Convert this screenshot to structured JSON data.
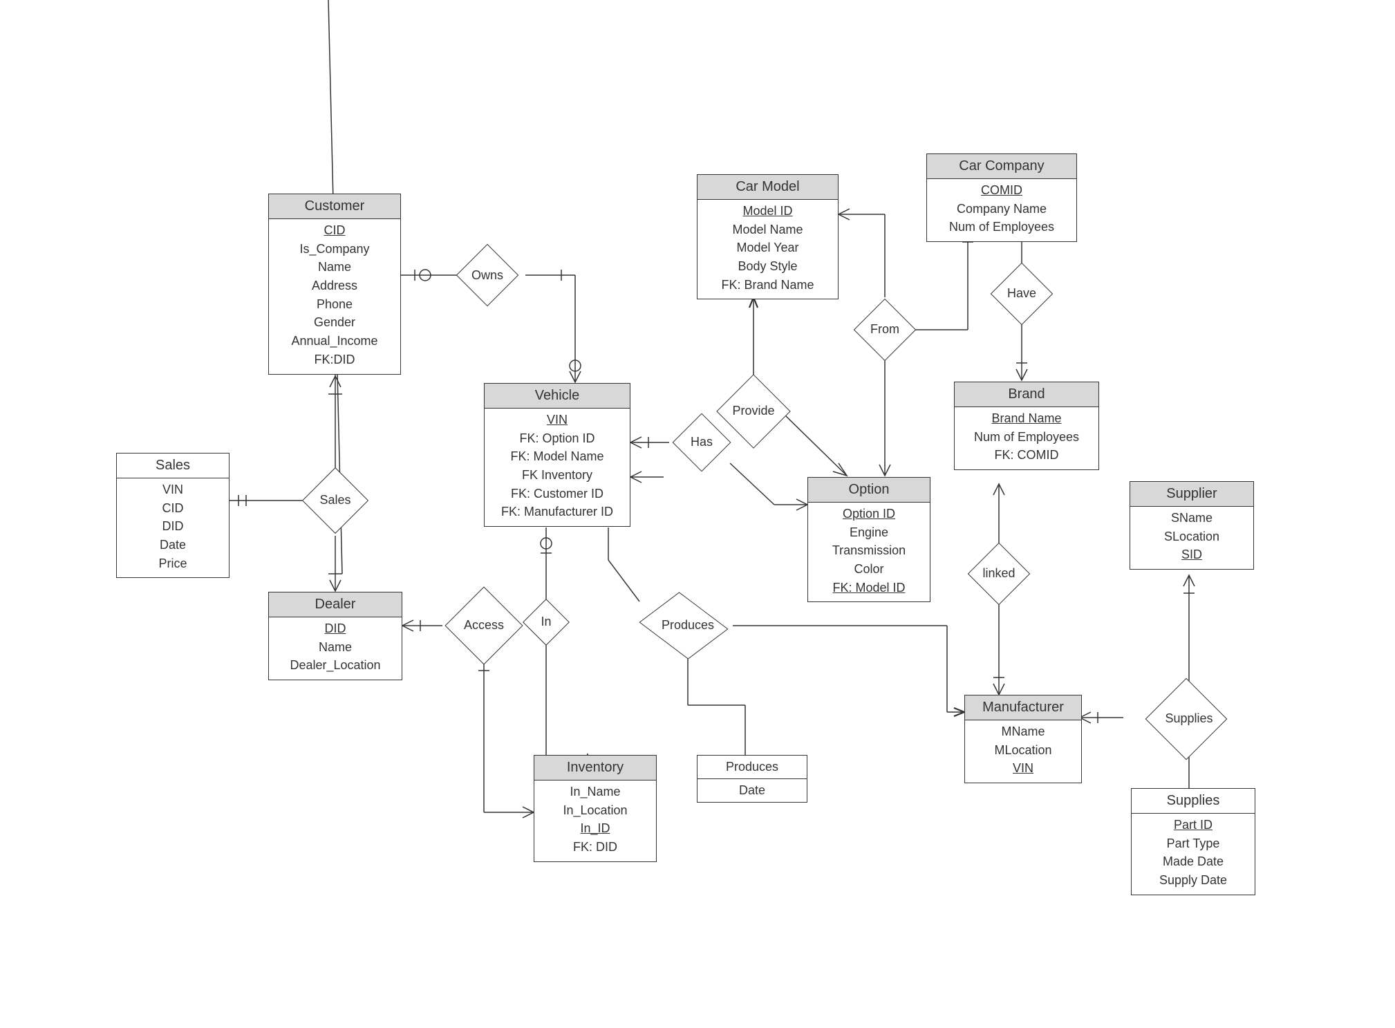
{
  "entities": {
    "customer": {
      "title": "Customer",
      "attrs": [
        "CID",
        "Is_Company",
        "Name",
        "Address",
        "Phone",
        "Gender",
        "Annual_Income",
        "FK:DID"
      ],
      "pk": [
        "CID"
      ]
    },
    "sales": {
      "title": "Sales",
      "attrs": [
        "VIN",
        "CID",
        "DID",
        "Date",
        "Price"
      ],
      "pk": []
    },
    "dealer": {
      "title": "Dealer",
      "attrs": [
        "DID",
        "Name",
        "Dealer_Location"
      ],
      "pk": [
        "DID"
      ]
    },
    "vehicle": {
      "title": "Vehicle",
      "attrs": [
        "VIN",
        "FK: Option ID",
        "FK: Model Name",
        "FK Inventory",
        "FK: Customer ID",
        "FK: Manufacturer ID"
      ],
      "pk": [
        "VIN"
      ]
    },
    "inventory": {
      "title": "Inventory",
      "attrs": [
        "In_Name",
        "In_Location",
        "In_ID",
        "FK: DID"
      ],
      "pk": [
        "In_ID"
      ]
    },
    "carModel": {
      "title": "Car Model",
      "attrs": [
        "Model ID",
        "Model Name",
        "Model Year",
        "Body Style",
        "FK: Brand Name"
      ],
      "pk": [
        "Model ID"
      ]
    },
    "option": {
      "title": "Option",
      "attrs": [
        "Option ID",
        "Engine",
        "Transmission",
        "Color",
        "FK: Model ID"
      ],
      "pk": [
        "Option ID"
      ]
    },
    "carCompany": {
      "title": "Car Company",
      "attrs": [
        "COMID",
        "Company Name",
        "Num of Employees"
      ],
      "pk": [
        "COMID"
      ]
    },
    "brand": {
      "title": "Brand",
      "attrs": [
        "Brand Name",
        "Num of Employees",
        "FK: COMID"
      ],
      "pk": [
        "Brand Name"
      ]
    },
    "supplier": {
      "title": "Supplier",
      "attrs": [
        "SName",
        "SLocation",
        "SID"
      ],
      "pk": [
        "SID"
      ]
    },
    "manufacturer": {
      "title": "Manufacturer",
      "attrs": [
        "MName",
        "MLocation",
        "VIN"
      ],
      "pk": [
        "VIN"
      ]
    },
    "supplies": {
      "title": "Supplies",
      "attrs": [
        "Part ID",
        "Part Type",
        "Made Date",
        "Supply Date"
      ],
      "pk": [
        "Part ID"
      ]
    }
  },
  "relationships": {
    "owns": "Owns",
    "salesRel": "Sales",
    "access": "Access",
    "in": "In",
    "has": "Has",
    "provide": "Provide",
    "produces": "Produces",
    "from": "From",
    "have": "Have",
    "linked": "linked",
    "suppliesRel": "Supplies"
  },
  "relAttrs": {
    "produces": {
      "title": "Produces",
      "rows": [
        "Date"
      ]
    }
  }
}
